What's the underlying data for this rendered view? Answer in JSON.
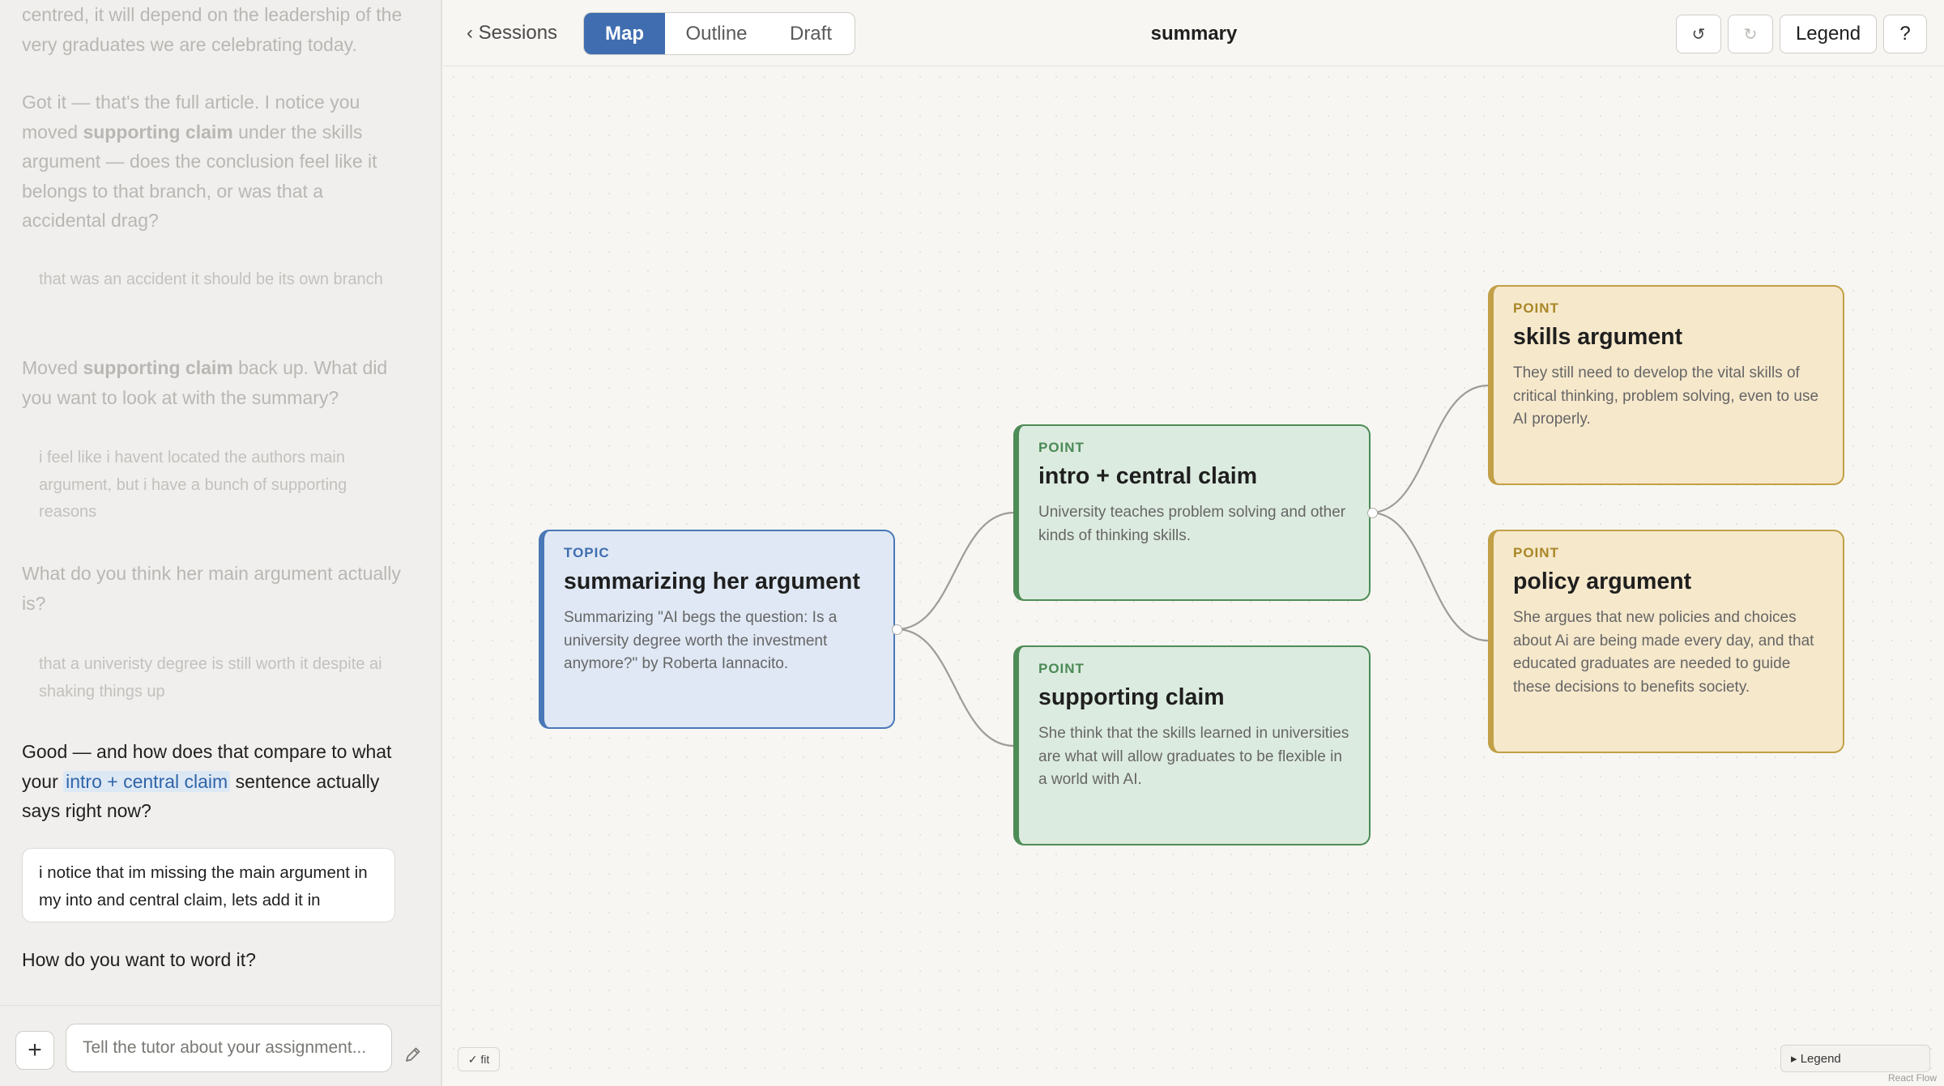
{
  "chat": {
    "messages": [
      {
        "role": "tutor",
        "state": "faded",
        "parts": [
          {
            "t": "centred, it will depend on the leadership of the very graduates we are celebrating today."
          }
        ]
      },
      {
        "role": "tutor",
        "state": "faded",
        "parts": [
          {
            "t": "Got it — that's the full article. I notice you moved "
          },
          {
            "t": "supporting claim",
            "ref": true
          },
          {
            "t": " under the skills argument — does the conclusion feel like it belongs to that branch, or was that a accidental drag?"
          }
        ]
      },
      {
        "role": "user",
        "state": "faded",
        "parts": [
          {
            "t": "that was an accident it should be its own branch"
          }
        ]
      },
      {
        "role": "tutor",
        "state": "faded",
        "parts": [
          {
            "t": "Moved "
          },
          {
            "t": "supporting claim",
            "ref": true
          },
          {
            "t": " back up. What did you want to look at with the summary?"
          }
        ]
      },
      {
        "role": "user",
        "state": "faded",
        "parts": [
          {
            "t": "i feel like i havent located the authors main argument, but i have a bunch of supporting reasons"
          }
        ]
      },
      {
        "role": "tutor",
        "state": "faded",
        "parts": [
          {
            "t": "What do you think her main argument actually is?"
          }
        ]
      },
      {
        "role": "user",
        "state": "faded",
        "parts": [
          {
            "t": "that a univeristy degree is still worth it despite ai shaking things up"
          }
        ]
      },
      {
        "role": "tutor",
        "state": "active",
        "parts": [
          {
            "t": "Good — and how does that compare to what your "
          },
          {
            "t": "intro + central claim",
            "ref": true
          },
          {
            "t": " sentence actually says right now?"
          }
        ]
      },
      {
        "role": "user",
        "state": "active",
        "parts": [
          {
            "t": "i notice that im missing the main argument in my into and central claim, lets add it in"
          }
        ]
      },
      {
        "role": "tutor",
        "state": "active",
        "parts": [
          {
            "t": "How do you want to word it?"
          }
        ]
      }
    ],
    "input_placeholder": "Tell the tutor about your assignment...",
    "add_label": "+"
  },
  "topbar": {
    "back_label": "‹ Sessions",
    "tabs": [
      {
        "label": "Map",
        "active": true
      },
      {
        "label": "Outline",
        "active": false
      },
      {
        "label": "Draft",
        "active": false
      }
    ],
    "title": "summary",
    "undo_label": "↺",
    "redo_label": "↻",
    "legend_label": "Legend",
    "help_label": "?"
  },
  "map": {
    "nodes": [
      {
        "id": "topic",
        "kind": "TOPIC",
        "title": "summarizing her argument",
        "body": "Summarizing \"AI begs the question: Is a university degree worth the investment anymore?\" by Roberta Iannacito.",
        "style": "topic"
      },
      {
        "id": "intro",
        "kind": "POINT",
        "title": "intro + central claim",
        "body": "University teaches problem solving and other kinds of thinking skills.",
        "style": "point-green"
      },
      {
        "id": "support",
        "kind": "POINT",
        "title": "supporting claim",
        "body": "She think that the skills learned in universities are what will allow graduates to be flexible in a world with AI.",
        "style": "point-green"
      },
      {
        "id": "skills",
        "kind": "POINT",
        "title": "skills argument",
        "body": "They still need to develop the vital skills of critical thinking, problem solving, even to use AI properly.",
        "style": "point-gold"
      },
      {
        "id": "policy",
        "kind": "POINT",
        "title": "policy argument",
        "body": "She argues that new policies and choices about Ai are being made every day, and that educated graduates are needed to guide these decisions to benefits society.",
        "style": "point-gold"
      }
    ],
    "edges": [
      {
        "from": "topic",
        "to": "intro"
      },
      {
        "from": "topic",
        "to": "support"
      },
      {
        "from": "intro",
        "to": "skills"
      },
      {
        "from": "intro",
        "to": "policy"
      }
    ],
    "fit_label": "✓ fit",
    "legend_toggle_label": "▸ Legend",
    "attribution": "React Flow",
    "colors": {
      "topic_border": "#4a77b8",
      "green_border": "#4e8c57",
      "gold_border": "#c2a047",
      "edge": "#9e9c97",
      "active_tab": "#3f6db0"
    }
  }
}
